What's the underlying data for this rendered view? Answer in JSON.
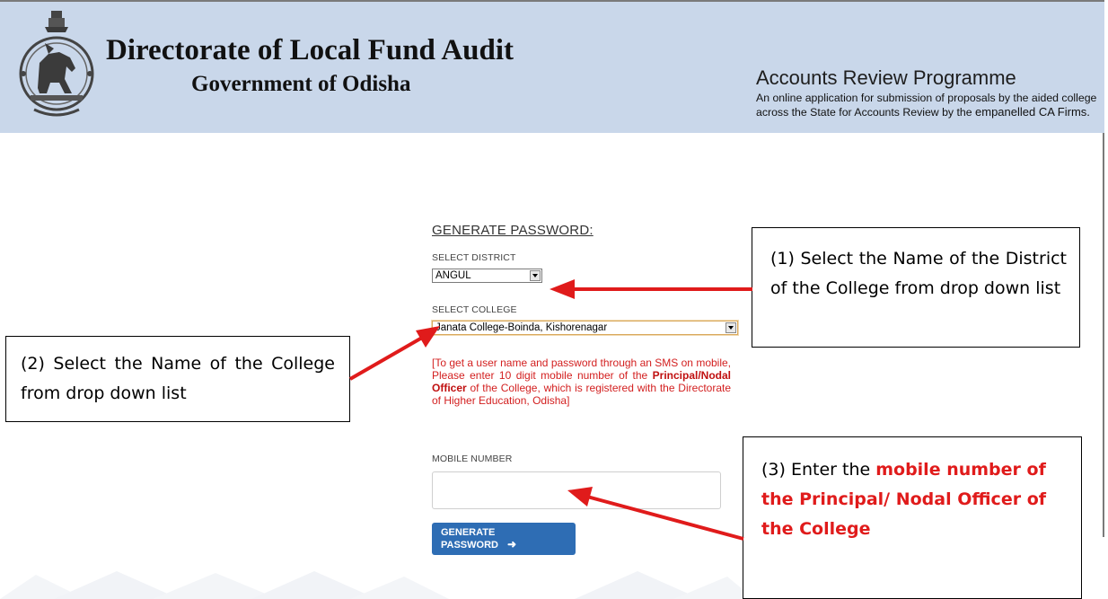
{
  "header": {
    "org_title": "Directorate of Local Fund Audit",
    "org_subtitle": "Government of Odisha",
    "program_title": "Accounts Review Programme",
    "program_desc_line1": "An online application for submission of proposals by the aided college",
    "program_desc_line2_a": "across the State for  Accounts Review by the ",
    "program_desc_line2_b": "empanelled CA Firms.",
    "emblem_icon": "odisha-government-emblem-icon",
    "background_color": "#c9d7ea"
  },
  "form": {
    "heading": "GENERATE PASSWORD:",
    "district_label": "SELECT DISTRICT",
    "district_value": "ANGUL",
    "college_label": "SELECT COLLEGE",
    "college_value": "Janata College-Boinda, Kishorenagar",
    "notice_part1": "[To get a user name and password through an SMS on mobile, Please enter 10 digit mobile number of the ",
    "notice_bold": "Principal/Nodal Officer",
    "notice_part2": " of the College, which is registered with the Directorate of Higher Education, Odisha]",
    "mobile_label": "MOBILE NUMBER",
    "mobile_value": "",
    "button_label": "GENERATE PASSWORD",
    "button_icon": "arrow-right-icon",
    "button_color": "#2e6db4",
    "notice_color": "#d32020"
  },
  "callouts": {
    "step1": "(1) Select the Name of the District of the College from drop down list",
    "step2": "(2) Select the Name of the College from drop down list",
    "step3_prefix": "(3) Enter the ",
    "step3_highlight": "mobile number of the Principal/ Nodal Officer of the College",
    "arrow_color": "#e01b1b"
  }
}
